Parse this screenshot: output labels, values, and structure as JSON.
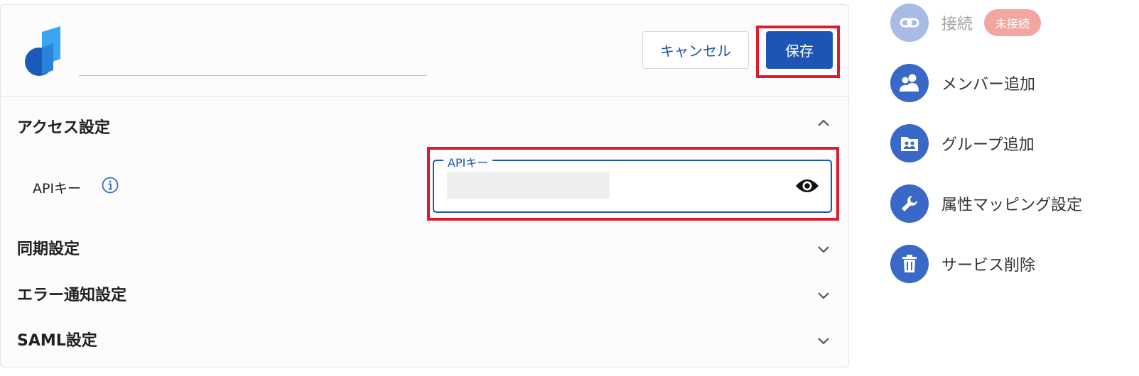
{
  "header": {
    "name_value": "",
    "cancel_label": "キャンセル",
    "save_label": "保存"
  },
  "sections": {
    "access": {
      "title": "アクセス設定",
      "expanded": true,
      "api_key_label": "APIキー",
      "api_key_field_label": "APIキー",
      "api_key_value": ""
    },
    "sync": {
      "title": "同期設定",
      "expanded": false
    },
    "error_notify": {
      "title": "エラー通知設定",
      "expanded": false
    },
    "saml": {
      "title": "SAML設定",
      "expanded": false
    }
  },
  "side_menu": {
    "connect": {
      "label": "接続",
      "status_badge": "未接続",
      "icon": "link-icon"
    },
    "add_member": {
      "label": "メンバー追加",
      "icon": "people-icon"
    },
    "add_group": {
      "label": "グループ追加",
      "icon": "group-folder-icon"
    },
    "attr_mapping": {
      "label": "属性マッピング設定",
      "icon": "wrench-icon"
    },
    "delete_service": {
      "label": "サービス削除",
      "icon": "trash-icon"
    }
  },
  "colors": {
    "primary": "#1c55b4",
    "highlight": "#e0192d",
    "side_icon": "#3a68c6",
    "badge": "#f2a6a0"
  }
}
